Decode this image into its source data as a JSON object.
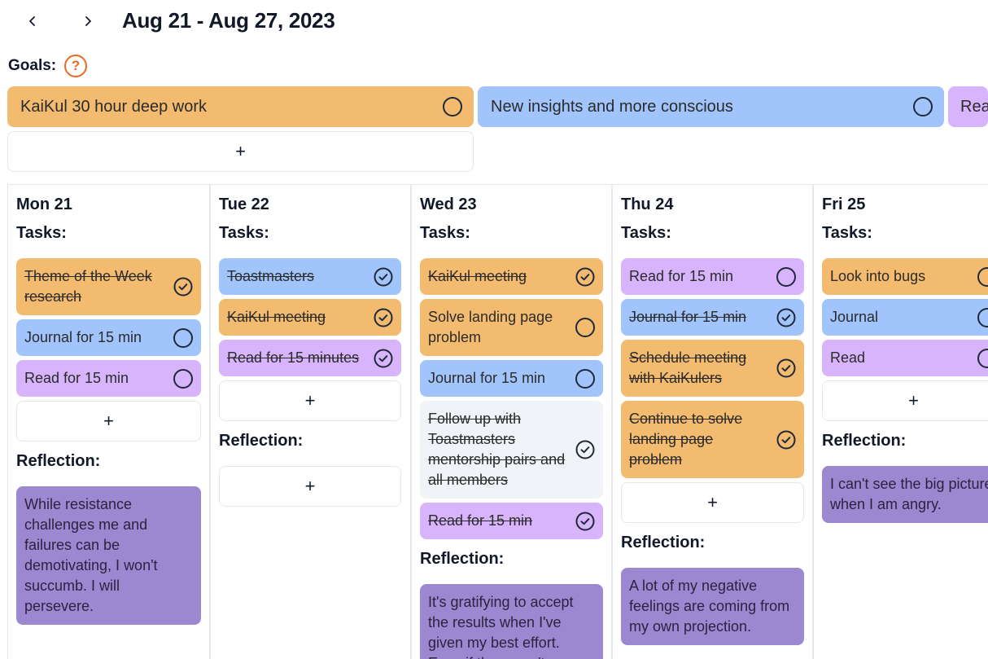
{
  "header": {
    "prev_icon": "chevron-left-icon",
    "next_icon": "chevron-right-icon",
    "date_range": "Aug 21 - Aug 27, 2023"
  },
  "goals": {
    "label": "Goals:",
    "help_symbol": "?",
    "items": [
      {
        "text": "KaiKul 30 hour deep work",
        "color": "#f2bb6f"
      },
      {
        "text": "New insights and more conscious",
        "color": "#a0c4fb"
      },
      {
        "text": "Rea",
        "color": "#d8b4fc"
      }
    ],
    "add_symbol": "+"
  },
  "labels": {
    "tasks": "Tasks:",
    "reflection": "Reflection:",
    "add_symbol": "+"
  },
  "days": [
    {
      "title": "Mon 21",
      "tasks": [
        {
          "text": "Theme of the Week research",
          "done": true,
          "color": "orange"
        },
        {
          "text": "Journal for 15 min",
          "done": false,
          "color": "blue"
        },
        {
          "text": "Read for 15 min",
          "done": false,
          "color": "purple"
        }
      ],
      "reflection": "While resistance challenges me and failures can be demotivating, I won't succumb. I will persevere."
    },
    {
      "title": "Tue 22",
      "tasks": [
        {
          "text": "Toastmasters",
          "done": true,
          "color": "blue"
        },
        {
          "text": "KaiKul meeting",
          "done": true,
          "color": "orange"
        },
        {
          "text": "Read for 15 minutes",
          "done": true,
          "color": "purple"
        }
      ],
      "reflection": ""
    },
    {
      "title": "Wed 23",
      "tasks": [
        {
          "text": "KaiKul meeting",
          "done": true,
          "color": "orange"
        },
        {
          "text": "Solve landing page problem",
          "done": false,
          "color": "orange"
        },
        {
          "text": "Journal for 15 min",
          "done": false,
          "color": "blue"
        },
        {
          "text": "Follow up with Toastmasters mentorship pairs and all members",
          "done": true,
          "color": "gray"
        },
        {
          "text": "Read for 15 min",
          "done": true,
          "color": "purple"
        }
      ],
      "reflection": "It's gratifying to accept the results when I've given my best effort. Even if they aren't"
    },
    {
      "title": "Thu 24",
      "tasks": [
        {
          "text": "Read for 15 min",
          "done": false,
          "color": "purple"
        },
        {
          "text": "Journal for 15 min",
          "done": true,
          "color": "blue"
        },
        {
          "text": "Schedule meeting with KaiKulers",
          "done": true,
          "color": "orange"
        },
        {
          "text": "Continue to solve landing page problem",
          "done": true,
          "color": "orange"
        }
      ],
      "reflection": "A lot of my negative feelings are coming from my own projection."
    },
    {
      "title": "Fri 25",
      "tasks": [
        {
          "text": "Look into bugs",
          "done": false,
          "color": "orange"
        },
        {
          "text": "Journal",
          "done": false,
          "color": "blue"
        },
        {
          "text": "Read",
          "done": false,
          "color": "purple"
        }
      ],
      "reflection": "I can't see the big picture when I am angry."
    }
  ]
}
